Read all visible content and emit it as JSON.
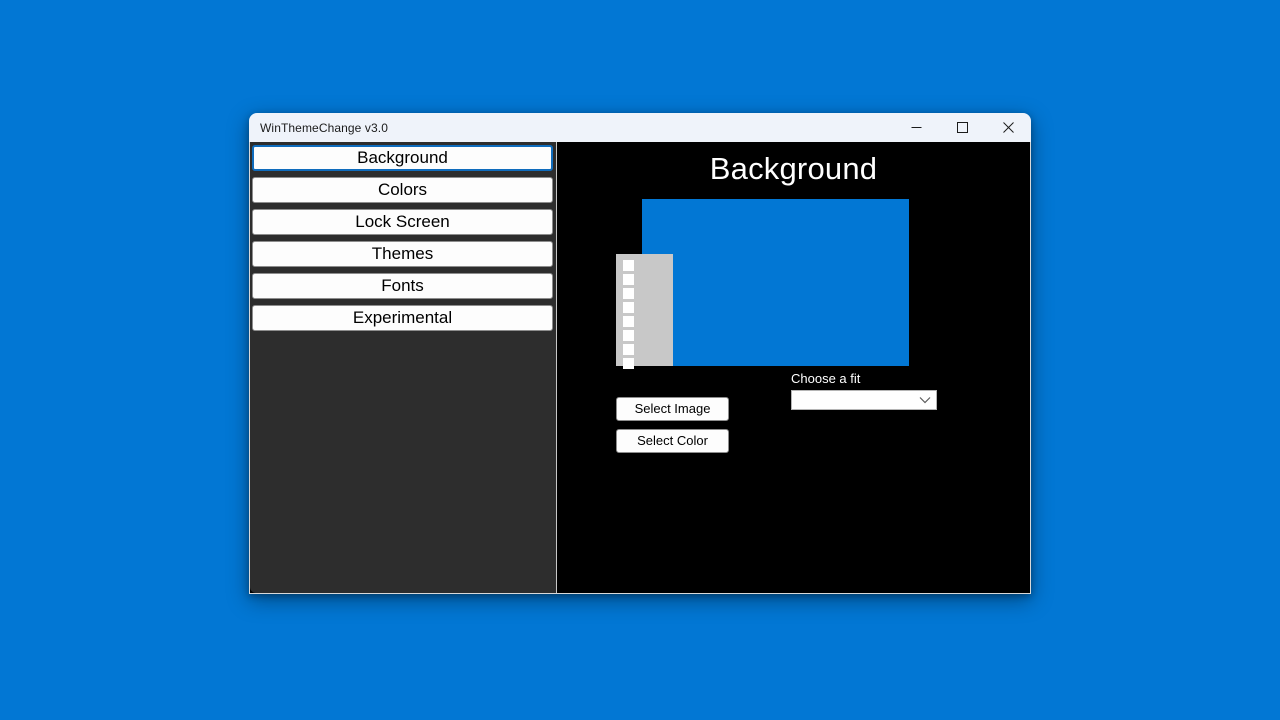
{
  "desktop": {
    "background_color": "#0277d4"
  },
  "window": {
    "title": "WinThemeChange v3.0",
    "controls": {
      "minimize_name": "minimize-icon",
      "maximize_name": "maximize-icon",
      "close_name": "close-icon"
    }
  },
  "sidebar": {
    "items": [
      {
        "label": "Background",
        "selected": true
      },
      {
        "label": "Colors",
        "selected": false
      },
      {
        "label": "Lock Screen",
        "selected": false
      },
      {
        "label": "Themes",
        "selected": false
      },
      {
        "label": "Fonts",
        "selected": false
      },
      {
        "label": "Experimental",
        "selected": false
      }
    ],
    "background_color": "#2d2d2d",
    "selected_border_color": "#0f6cbd"
  },
  "content": {
    "page_title": "Background",
    "background_color": "#000000",
    "preview": {
      "color_swatch": "#0277d4",
      "filmstrip_color": "#c8c8c8",
      "perforation_color": "#ffffff",
      "perforation_count": 8,
      "icon_name": "image-placeholder-filmstrip"
    },
    "buttons": {
      "select_image": "Select Image",
      "select_color": "Select Color"
    },
    "fit": {
      "label": "Choose a fit",
      "selected_value": "",
      "placeholder": "",
      "chevron_icon": "chevron-down-icon"
    }
  }
}
